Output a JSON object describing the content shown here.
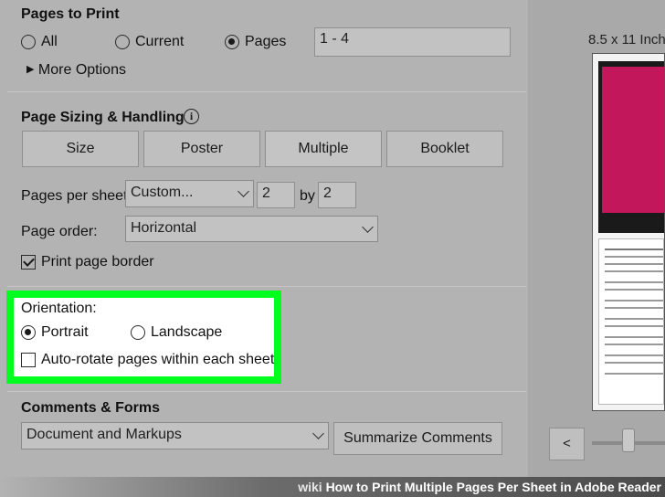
{
  "pages_to_print": {
    "title": "Pages to Print",
    "options": [
      "All",
      "Current",
      "Pages"
    ],
    "selected": "Pages",
    "pages_value": "1 - 4",
    "more_options": "More Options"
  },
  "page_sizing": {
    "title": "Page Sizing & Handling",
    "info_icon": "info-icon",
    "modes": [
      "Size",
      "Poster",
      "Multiple",
      "Booklet"
    ],
    "active_mode": "Multiple",
    "pages_per_sheet_label": "Pages per sheet:",
    "pages_per_sheet_value": "Custom...",
    "cols": "2",
    "by_label": "by",
    "rows": "2",
    "page_order_label": "Page order:",
    "page_order_value": "Horizontal",
    "print_border_label": "Print page border",
    "print_border_checked": true
  },
  "orientation": {
    "title": "Orientation:",
    "portrait": "Portrait",
    "landscape": "Landscape",
    "selected": "Portrait",
    "auto_rotate": "Auto-rotate pages within each sheet",
    "auto_rotate_checked": false,
    "highlight_color": "#00ff1f"
  },
  "comments_forms": {
    "title": "Comments & Forms",
    "value": "Document and Markups",
    "summarize_button": "Summarize Comments"
  },
  "preview": {
    "paper_size": "8.5 x 11 Inch",
    "prev_button": "<"
  },
  "banner": {
    "wiki": "wiki",
    "text": "How to Print Multiple Pages Per Sheet in Adobe Reader"
  }
}
